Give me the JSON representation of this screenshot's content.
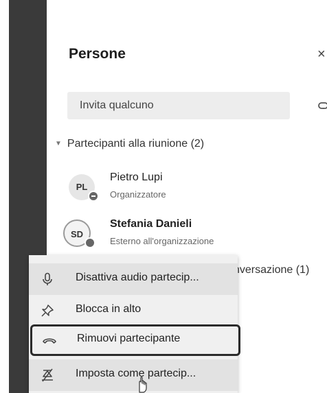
{
  "panel": {
    "title": "Persone",
    "close_glyph": "×"
  },
  "invite": {
    "placeholder": "Invita qualcuno"
  },
  "section": {
    "label": "Partecipanti alla riunione (2)",
    "caret": "▼"
  },
  "participants": [
    {
      "initials": "PL",
      "name": "Pietro Lupi",
      "role": "Organizzatore",
      "status_icon": "minus-status-icon"
    },
    {
      "initials": "SD",
      "name": "Stefania Danieli",
      "role": "Esterno all'organizzazione",
      "status_icon": "offline-status-icon"
    }
  ],
  "background_fragments": {
    "conversation_header": "nversazione (1)",
    "e_letter": "e"
  },
  "context_menu": {
    "items": [
      {
        "label": "Disattiva audio partecip...",
        "icon": "microphone-icon"
      },
      {
        "label": "Blocca in alto",
        "icon": "pin-icon"
      },
      {
        "label": "Rimuovi partecipante",
        "icon": "hang-up-icon"
      },
      {
        "label": "Imposta come partecip...",
        "icon": "attendee-icon"
      }
    ]
  },
  "colors": {
    "dark_rail": "#3a3a3a",
    "menu_bg": "#f0f0f0",
    "highlight_border": "#2b2b2b"
  }
}
